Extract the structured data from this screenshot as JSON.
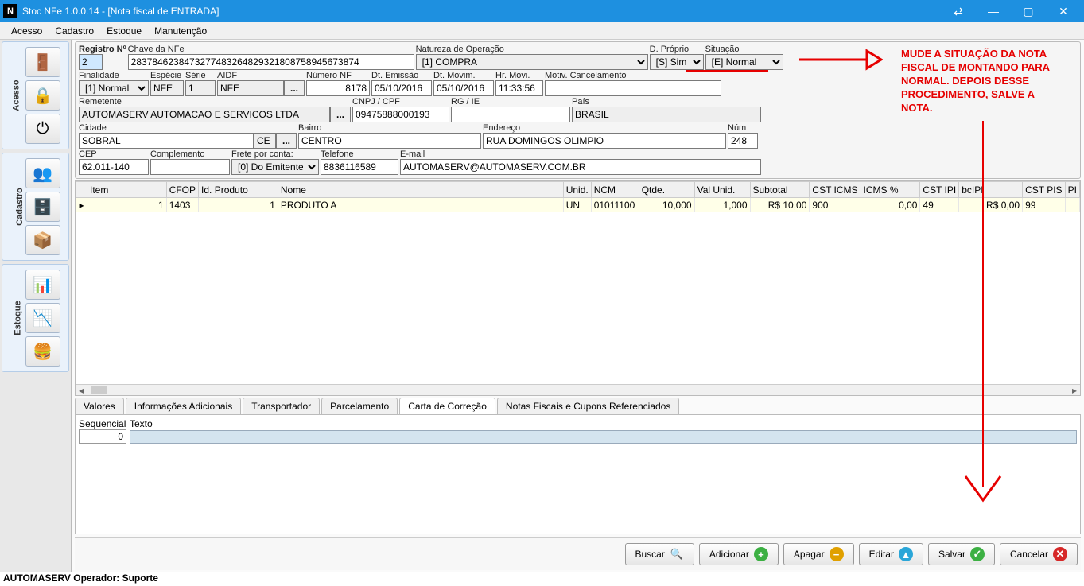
{
  "title": "Stoc NFe 1.0.0.14 - [Nota fiscal de ENTRADA]",
  "app_icon": "N",
  "menu": {
    "acesso": "Acesso",
    "cadastro": "Cadastro",
    "estoque": "Estoque",
    "manutencao": "Manutenção"
  },
  "sidebar": {
    "acesso": "Acesso",
    "cadastro": "Cadastro",
    "estoque": "Estoque"
  },
  "labels": {
    "registro": "Registro Nº",
    "chave": "Chave da NFe",
    "natureza": "Natureza de Operação",
    "dproprio": "D. Próprio",
    "situacao": "Situação",
    "finalidade": "Finalidade",
    "especie": "Espécie",
    "serie": "Série",
    "aidf": "AIDF",
    "numero": "Número NF",
    "dtemissao": "Dt. Emissão",
    "dtmovim": "Dt. Movim.",
    "hrmovi": "Hr. Movi.",
    "motivcancel": "Motiv. Cancelamento",
    "remetente": "Remetente",
    "cnpj": "CNPJ / CPF",
    "rgie": "RG / IE",
    "pais": "País",
    "cidade": "Cidade",
    "bairro": "Bairro",
    "endereco": "Endereço",
    "num": "Núm",
    "cep": "CEP",
    "complemento": "Complemento",
    "frete": "Frete por conta:",
    "telefone": "Telefone",
    "email": "E-mail",
    "sequencial": "Sequencial",
    "texto": "Texto"
  },
  "values": {
    "registro": "2",
    "chave": "2837846238473277483264829321808758945673874",
    "natureza": "[1]  COMPRA",
    "dproprio": "[S] Sim",
    "situacao": "[E] Normal",
    "finalidade": "[1] Normal",
    "especie": "NFE",
    "serie": "1",
    "aidf": "NFE",
    "numero": "8178",
    "dtemissao": "05/10/2016",
    "dtmovim": "05/10/2016",
    "hrmovi": "11:33:56",
    "motivcancel": "",
    "remetente": "AUTOMASERV AUTOMACAO E SERVICOS LTDA",
    "cnpj": "09475888000193",
    "rgie": "",
    "pais": "BRASIL",
    "cidade": "SOBRAL",
    "uf": "CE",
    "bairro": "CENTRO",
    "endereco": "RUA DOMINGOS OLIMPIO",
    "num": "248",
    "cep": "62.011-140",
    "complemento": "",
    "frete": "[0] Do Emitente",
    "telefone": "8836116589",
    "email": "AUTOMASERV@AUTOMASERV.COM.BR",
    "sequencial": "0"
  },
  "grid": {
    "headers": {
      "item": "Item",
      "cfop": "CFOP",
      "idprod": "Id. Produto",
      "nome": "Nome",
      "unid": "Unid.",
      "ncm": "NCM",
      "qtde": "Qtde.",
      "valunid": "Val Unid.",
      "subtotal": "Subtotal",
      "csticms": "CST ICMS",
      "icmspct": "ICMS %",
      "cstipi": "CST IPI",
      "bcipi": "bcIPI",
      "cstpis": "CST PIS",
      "pi": "PI"
    },
    "row": {
      "item": "1",
      "cfop": "1403",
      "idprod": "1",
      "nome": "PRODUTO A",
      "unid": "UN",
      "ncm": "01011100",
      "qtde": "10,000",
      "valunid": "1,000",
      "subtotal": "R$ 10,00",
      "csticms": "900",
      "icmspct": "0,00",
      "cstipi": "49",
      "bcipi": "R$ 0,00",
      "cstpis": "99"
    }
  },
  "tabs": {
    "valores": "Valores",
    "info": "Informações Adicionais",
    "transp": "Transportador",
    "parcel": "Parcelamento",
    "carta": "Carta de Correção",
    "notas": "Notas Fiscais e Cupons Referenciados"
  },
  "buttons": {
    "buscar": "Buscar",
    "adicionar": "Adicionar",
    "apagar": "Apagar",
    "editar": "Editar",
    "salvar": "Salvar",
    "cancelar": "Cancelar"
  },
  "annotation": "MUDE A SITUAÇÃO DA NOTA FISCAL DE MONTANDO PARA NORMAL. DEPOIS DESSE PROCEDIMENTO, SALVE A NOTA.",
  "status": "AUTOMASERV Operador: Suporte"
}
